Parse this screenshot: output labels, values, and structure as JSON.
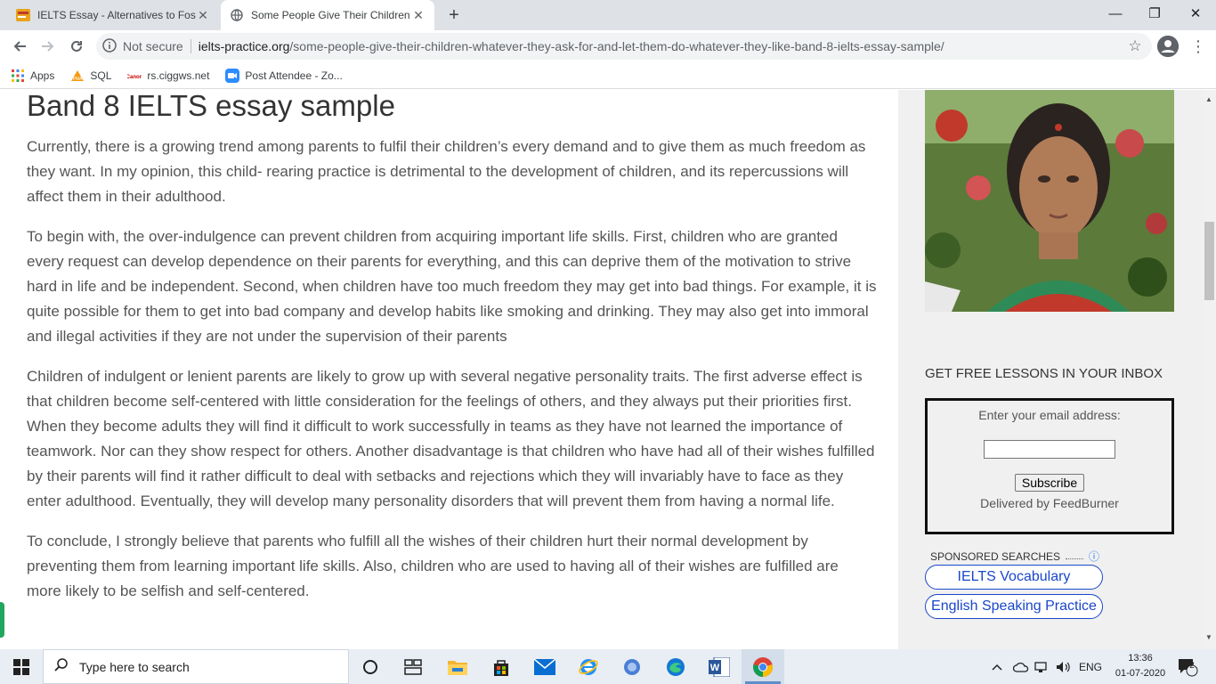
{
  "browser": {
    "tabs": [
      {
        "title": "IELTS Essay - Alternatives to Fossil",
        "close": "✕"
      },
      {
        "title": "Some People Give Their Children",
        "close": "✕"
      }
    ],
    "new_tab": "+",
    "window_controls": {
      "minimize": "—",
      "restore": "❐",
      "close": "✕"
    },
    "toolbar": {
      "security_label": "Not secure",
      "url_host": "ielts-practice.org",
      "url_path": "/some-people-give-their-children-whatever-they-ask-for-and-let-them-do-whatever-they-like-band-8-ielts-essay-sample/"
    },
    "bookmarks": [
      {
        "label": "Apps",
        "icon": "apps-grid-icon"
      },
      {
        "label": "SQL",
        "icon": "sql-icon"
      },
      {
        "label": "rs.ciggws.net",
        "icon": "canon-icon"
      },
      {
        "label": "Post Attendee - Zo...",
        "icon": "zoom-icon"
      }
    ]
  },
  "article": {
    "heading": "Band 8 IELTS essay sample",
    "paragraphs": [
      "Currently, there is a growing trend among parents to fulfil their children’s every demand and to give them as much freedom as they want. In my opinion, this child- rearing practice is detrimental to the development of children, and its repercussions will affect them in their adulthood.",
      "To begin with, the over-indulgence can prevent children from acquiring important life skills. First, children who are granted every request can develop dependence on their parents for everything, and this can deprive them of the motivation to strive hard in life and be independent. Second, when children have too much freedom they may get into bad things. For example, it is quite possible for them to get into bad company and develop habits like smoking and drinking. They may also get into immoral and illegal activities if they are not under the supervision of their parents",
      "Children of indulgent or lenient parents are likely to grow up with several negative personality traits. The first adverse effect is that children become self-centered with little consideration for the feelings of others, and they always put their priorities first. When they become adults they will find it difficult to work successfully in teams as they have not learned the importance of teamwork. Nor can they show respect for others. Another disadvantage is that children who have had all of their wishes fulfilled by their parents will find it rather difficult to deal with setbacks and rejections which they will invariably have to face as they enter adulthood. Eventually, they will develop many personality disorders that will prevent them from having a normal life.",
      "To conclude, I strongly believe that parents who fulfill all the wishes of their children hurt their normal development by preventing them from learning important life skills. Also, children who are used to having all of their wishes are fulfilled are more likely to be selfish and self-centered."
    ]
  },
  "sidebar": {
    "subscribe_heading": "GET FREE LESSONS IN YOUR INBOX",
    "email_label": "Enter your email address:",
    "subscribe_button": "Subscribe",
    "delivered_by": "Delivered by FeedBurner",
    "sponsored_label": "SPONSORED SEARCHES",
    "sponsored_links": [
      "IELTS Vocabulary",
      "English Speaking Practice"
    ]
  },
  "taskbar": {
    "search_placeholder": "Type here to search",
    "language": "ENG",
    "time": "13:36",
    "date": "01-07-2020",
    "notification_count": "2",
    "apps": [
      "cortana-icon",
      "task-view-icon",
      "file-explorer-icon",
      "store-icon",
      "mail-icon",
      "ie-icon",
      "cortana-circle-icon",
      "edge-icon",
      "word-icon",
      "chrome-icon"
    ]
  },
  "colors": {
    "tab_strip": "#dee1e6",
    "taskbar": "#e9eef5",
    "link_blue": "#1a47c9",
    "sidebar_bg": "#f0f0f0",
    "body_text": "#555555"
  }
}
